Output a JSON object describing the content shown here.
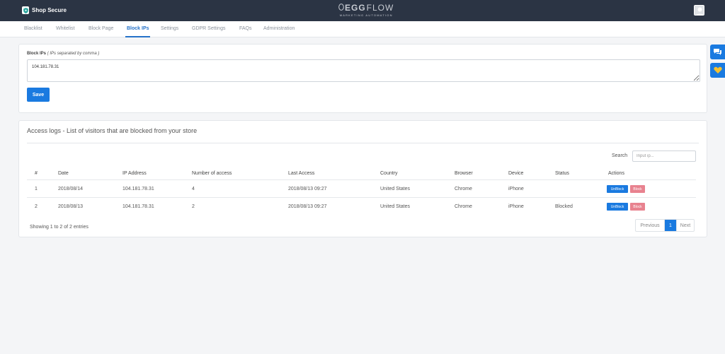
{
  "app": {
    "name": "Shop Secure"
  },
  "logo": {
    "main_prefix": "EGG",
    "main_suffix": "FLOW",
    "subtitle": "MARKETING AUTOMATION"
  },
  "nav": {
    "items": [
      {
        "label": "Blacklist"
      },
      {
        "label": "Whitelist"
      },
      {
        "label": "Block Page"
      },
      {
        "label": "Block IPs",
        "active": true
      },
      {
        "label": "Settings"
      },
      {
        "label": "GDPR Settings"
      },
      {
        "label": "FAQs"
      },
      {
        "label": "Administration"
      }
    ]
  },
  "block_form": {
    "label": "Block IPs",
    "hint": "( IPs separated by comma )",
    "value": "104.181.78.31",
    "save_label": "Save"
  },
  "logs": {
    "title": "Access logs - List of visitors that are blocked from your store",
    "search_label": "Search",
    "search_placeholder": "Input ip...",
    "columns": [
      "#",
      "Date",
      "IP Address",
      "Number of access",
      "Last Access",
      "Country",
      "Browser",
      "Device",
      "Status",
      "Actions"
    ],
    "rows": [
      {
        "num": "1",
        "date": "2018/08/14",
        "ip": "104.181.78.31",
        "count": "4",
        "last_access": "2018/08/13 09:27",
        "country": "United States",
        "browser": "Chrome",
        "device": "iPhone",
        "status": ""
      },
      {
        "num": "2",
        "date": "2018/08/13",
        "ip": "104.181.78.31",
        "count": "2",
        "last_access": "2018/08/13 09:27",
        "country": "United States",
        "browser": "Chrome",
        "device": "iPhone",
        "status": "Blocked"
      }
    ],
    "unblock_label": "UnBlock",
    "block_label": "Block",
    "summary": "Showing 1 to 2 of 2 entries",
    "pager": {
      "prev": "Previous",
      "current": "1",
      "next": "Next"
    }
  },
  "colors": {
    "topbar": "#2b3444",
    "accent": "#1a7ae0",
    "block_button": "#e8828f"
  },
  "icons": {
    "brand": "shield-icon",
    "avatar": "user-icon",
    "side_top": "chat-icon",
    "side_bottom": "heart-icon"
  }
}
